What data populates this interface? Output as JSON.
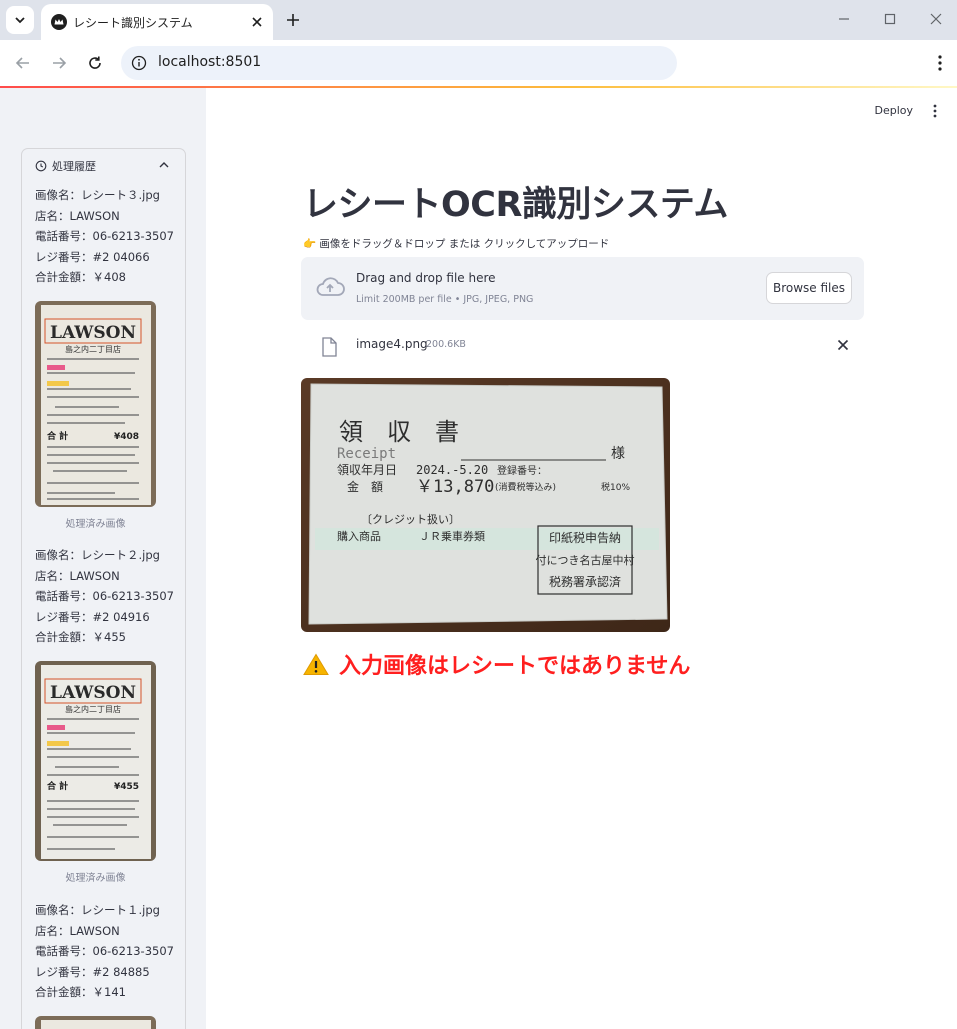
{
  "browser": {
    "tab_title": "レシート識別システム",
    "url": "localhost:8501"
  },
  "app": {
    "deploy_label": "Deploy",
    "title": "レシートOCR識別システム",
    "upload_label": "👉 画像をドラッグ＆ドロップ または クリックしてアップロード",
    "dropzone": {
      "title": "Drag and drop file here",
      "subtitle": "Limit 200MB per file • JPG, JPEG, PNG",
      "browse_label": "Browse files"
    },
    "uploaded_file": {
      "name": "image4.png",
      "size": "200.6KB"
    },
    "uploaded_image_text": {
      "heading": "領　収　書",
      "receipt_word": "Receipt",
      "sama": "様",
      "date_label": "領収年月日",
      "date": "2024.-5.20",
      "reg_label": "登録番号：",
      "amount_label": "金　額",
      "amount": "￥13,870",
      "tax_note": "(消費税等込み)",
      "tax_rate": "税10%",
      "credit": "〔クレジット扱い〕",
      "item_label": "購入商品",
      "item": "ＪＲ乗車券類",
      "stamp_lines": [
        "印紙税申告納",
        "付につき名古屋中村",
        "税務署承認済"
      ]
    },
    "warning": "入力画像はレシートではありません"
  },
  "sidebar": {
    "history_title": "処理履歴",
    "caption": "処理済み画像",
    "records": [
      {
        "image_name": "画像名：レシート３.jpg",
        "store": "店名：LAWSON",
        "phone": "電話番号：06-6213-3507",
        "register": "レジ番号：#2 04066",
        "total": "合計金額：￥408",
        "thumb_total": "¥408"
      },
      {
        "image_name": "画像名：レシート２.jpg",
        "store": "店名：LAWSON",
        "phone": "電話番号：06-6213-3507",
        "register": "レジ番号：#2 04916",
        "total": "合計金額：￥455",
        "thumb_total": "¥455"
      },
      {
        "image_name": "画像名：レシート１.jpg",
        "store": "店名：LAWSON",
        "phone": "電話番号：06-6213-3507",
        "register": "レジ番号：#2 84885",
        "total": "合計金額：￥141"
      }
    ],
    "thumb_text": {
      "brand": "LAWSON",
      "branch": "島之内二丁目店"
    }
  }
}
